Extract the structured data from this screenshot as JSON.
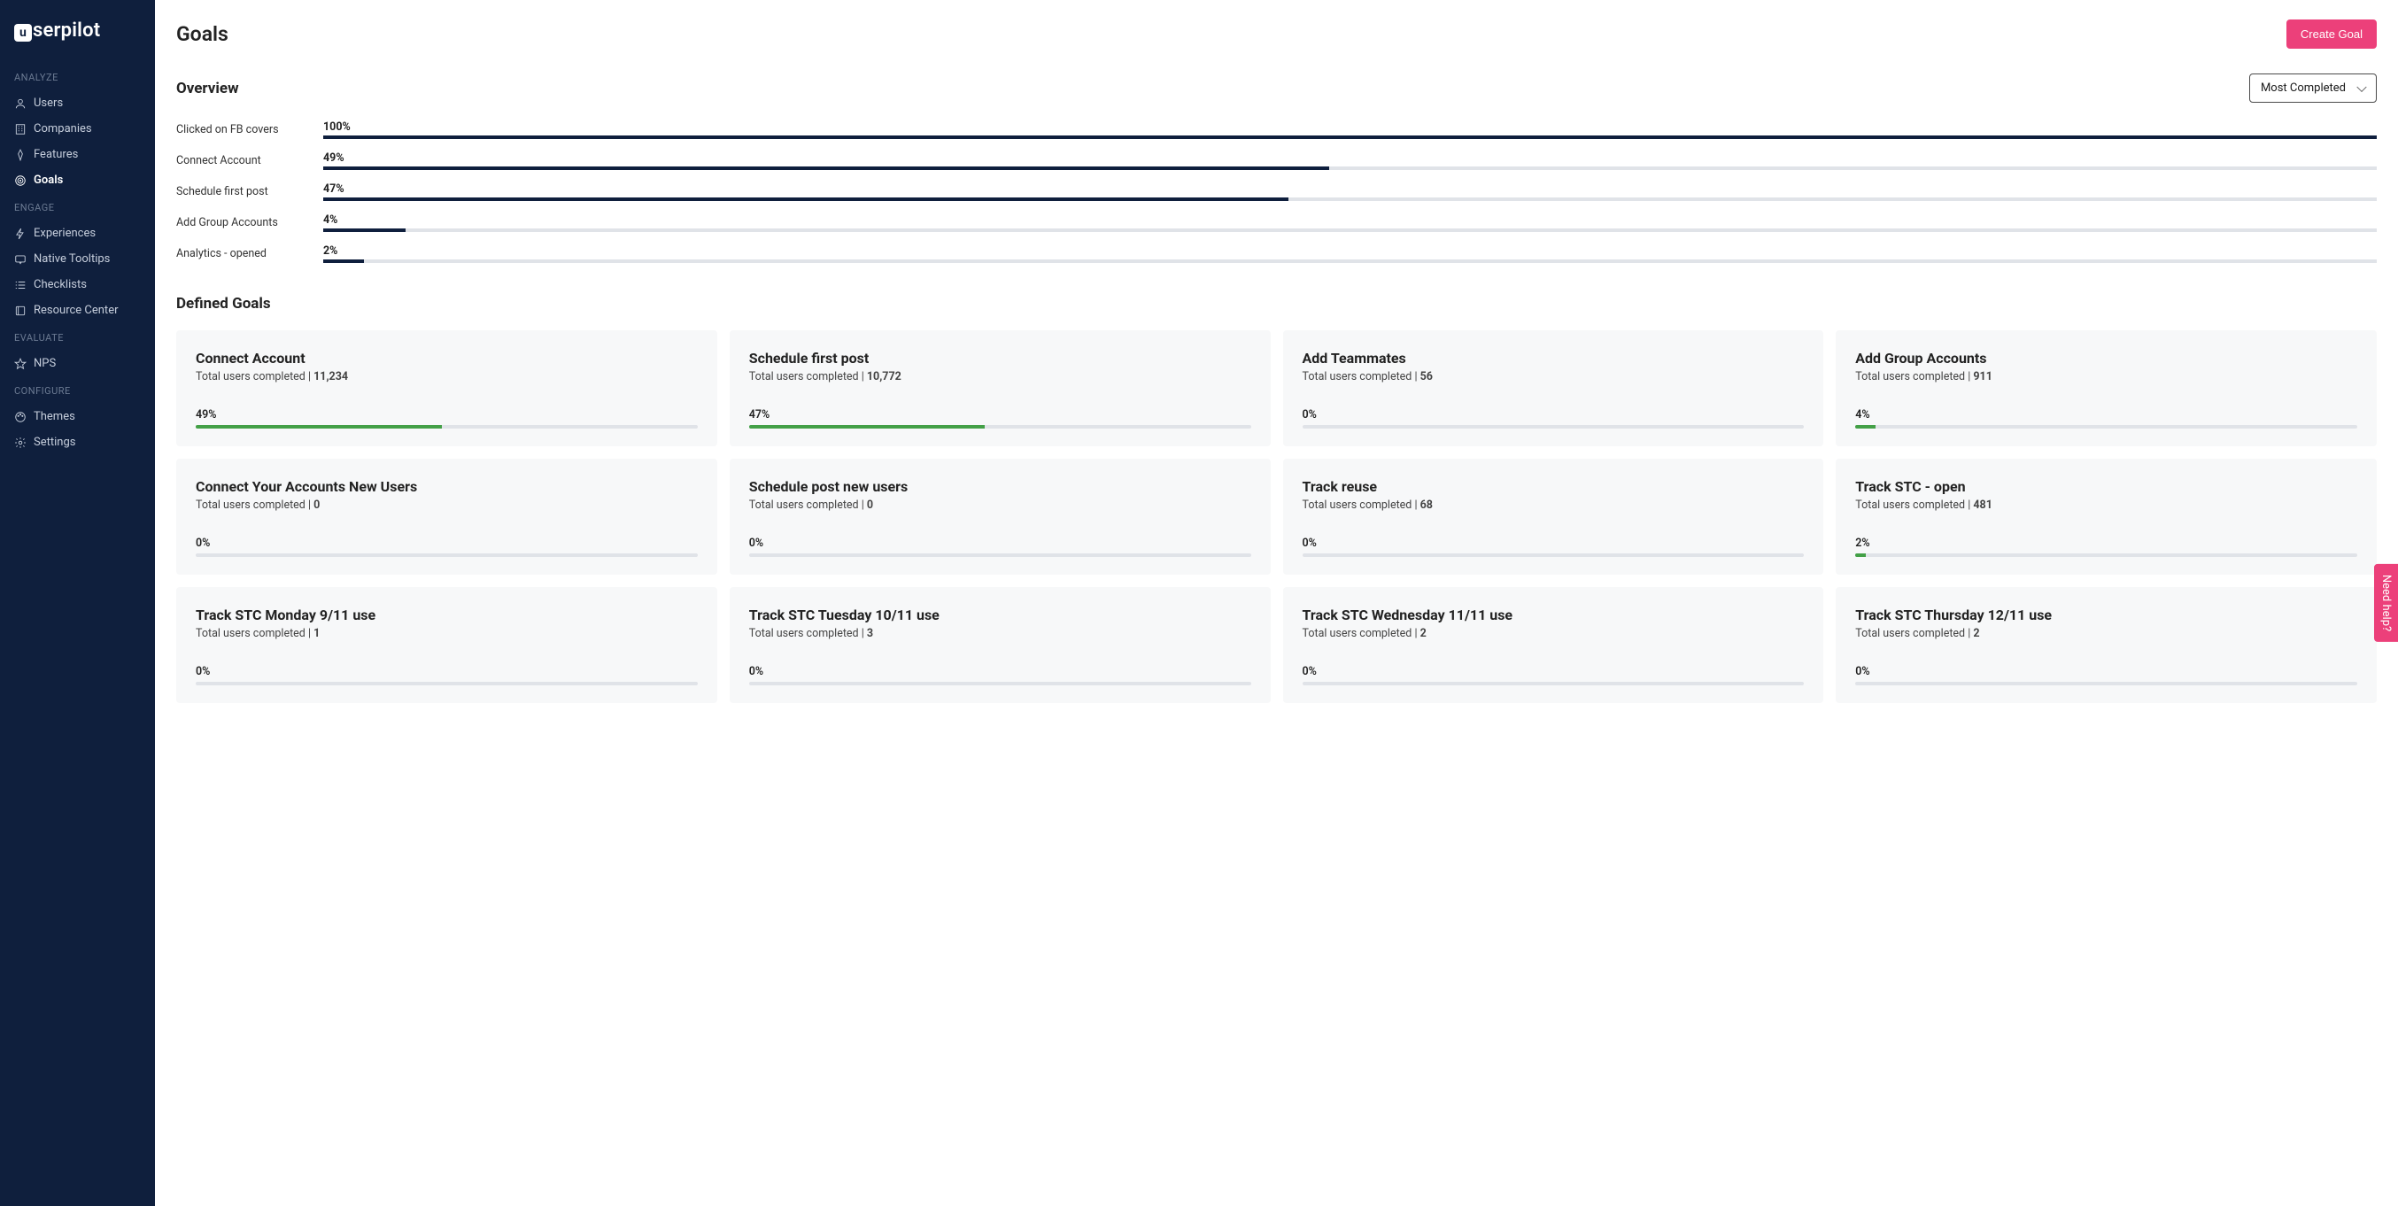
{
  "brand": "serpilot",
  "sidebar": {
    "sections": [
      {
        "label": "ANALYZE",
        "items": [
          {
            "label": "Users",
            "icon": "user-icon"
          },
          {
            "label": "Companies",
            "icon": "building-icon"
          },
          {
            "label": "Features",
            "icon": "compass-icon"
          },
          {
            "label": "Goals",
            "icon": "target-icon",
            "active": true
          }
        ]
      },
      {
        "label": "ENGAGE",
        "items": [
          {
            "label": "Experiences",
            "icon": "bolt-icon"
          },
          {
            "label": "Native Tooltips",
            "icon": "tooltip-icon"
          },
          {
            "label": "Checklists",
            "icon": "checklist-icon"
          },
          {
            "label": "Resource Center",
            "icon": "book-icon"
          }
        ]
      },
      {
        "label": "EVALUATE",
        "items": [
          {
            "label": "NPS",
            "icon": "star-icon"
          }
        ]
      },
      {
        "label": "CONFIGURE",
        "items": [
          {
            "label": "Themes",
            "icon": "palette-icon"
          },
          {
            "label": "Settings",
            "icon": "gear-icon"
          }
        ]
      }
    ]
  },
  "page": {
    "title": "Goals",
    "create_button": "Create Goal",
    "overview_title": "Overview",
    "sort_label": "Most Completed",
    "defined_title": "Defined Goals",
    "help_tab": "Need help?",
    "users_prefix": "Total users completed | "
  },
  "overview": [
    {
      "label": "Clicked on FB covers",
      "pct": 100
    },
    {
      "label": "Connect Account",
      "pct": 49
    },
    {
      "label": "Schedule first post",
      "pct": 47
    },
    {
      "label": "Add Group Accounts",
      "pct": 4
    },
    {
      "label": "Analytics - opened",
      "pct": 2
    }
  ],
  "goals": [
    {
      "title": "Connect Account",
      "count": "11,234",
      "pct": 49
    },
    {
      "title": "Schedule first post",
      "count": "10,772",
      "pct": 47
    },
    {
      "title": "Add Teammates",
      "count": "56",
      "pct": 0
    },
    {
      "title": "Add Group Accounts",
      "count": "911",
      "pct": 4
    },
    {
      "title": "Connect Your Accounts New Users",
      "count": "0",
      "pct": 0
    },
    {
      "title": "Schedule post new users",
      "count": "0",
      "pct": 0
    },
    {
      "title": "Track reuse",
      "count": "68",
      "pct": 0
    },
    {
      "title": "Track STC - open",
      "count": "481",
      "pct": 2
    },
    {
      "title": "Track STC Monday 9/11 use",
      "count": "1",
      "pct": 0
    },
    {
      "title": "Track STC Tuesday 10/11 use",
      "count": "3",
      "pct": 0
    },
    {
      "title": "Track STC Wednesday 11/11 use",
      "count": "2",
      "pct": 0
    },
    {
      "title": "Track STC Thursday 12/11 use",
      "count": "2",
      "pct": 0
    }
  ]
}
